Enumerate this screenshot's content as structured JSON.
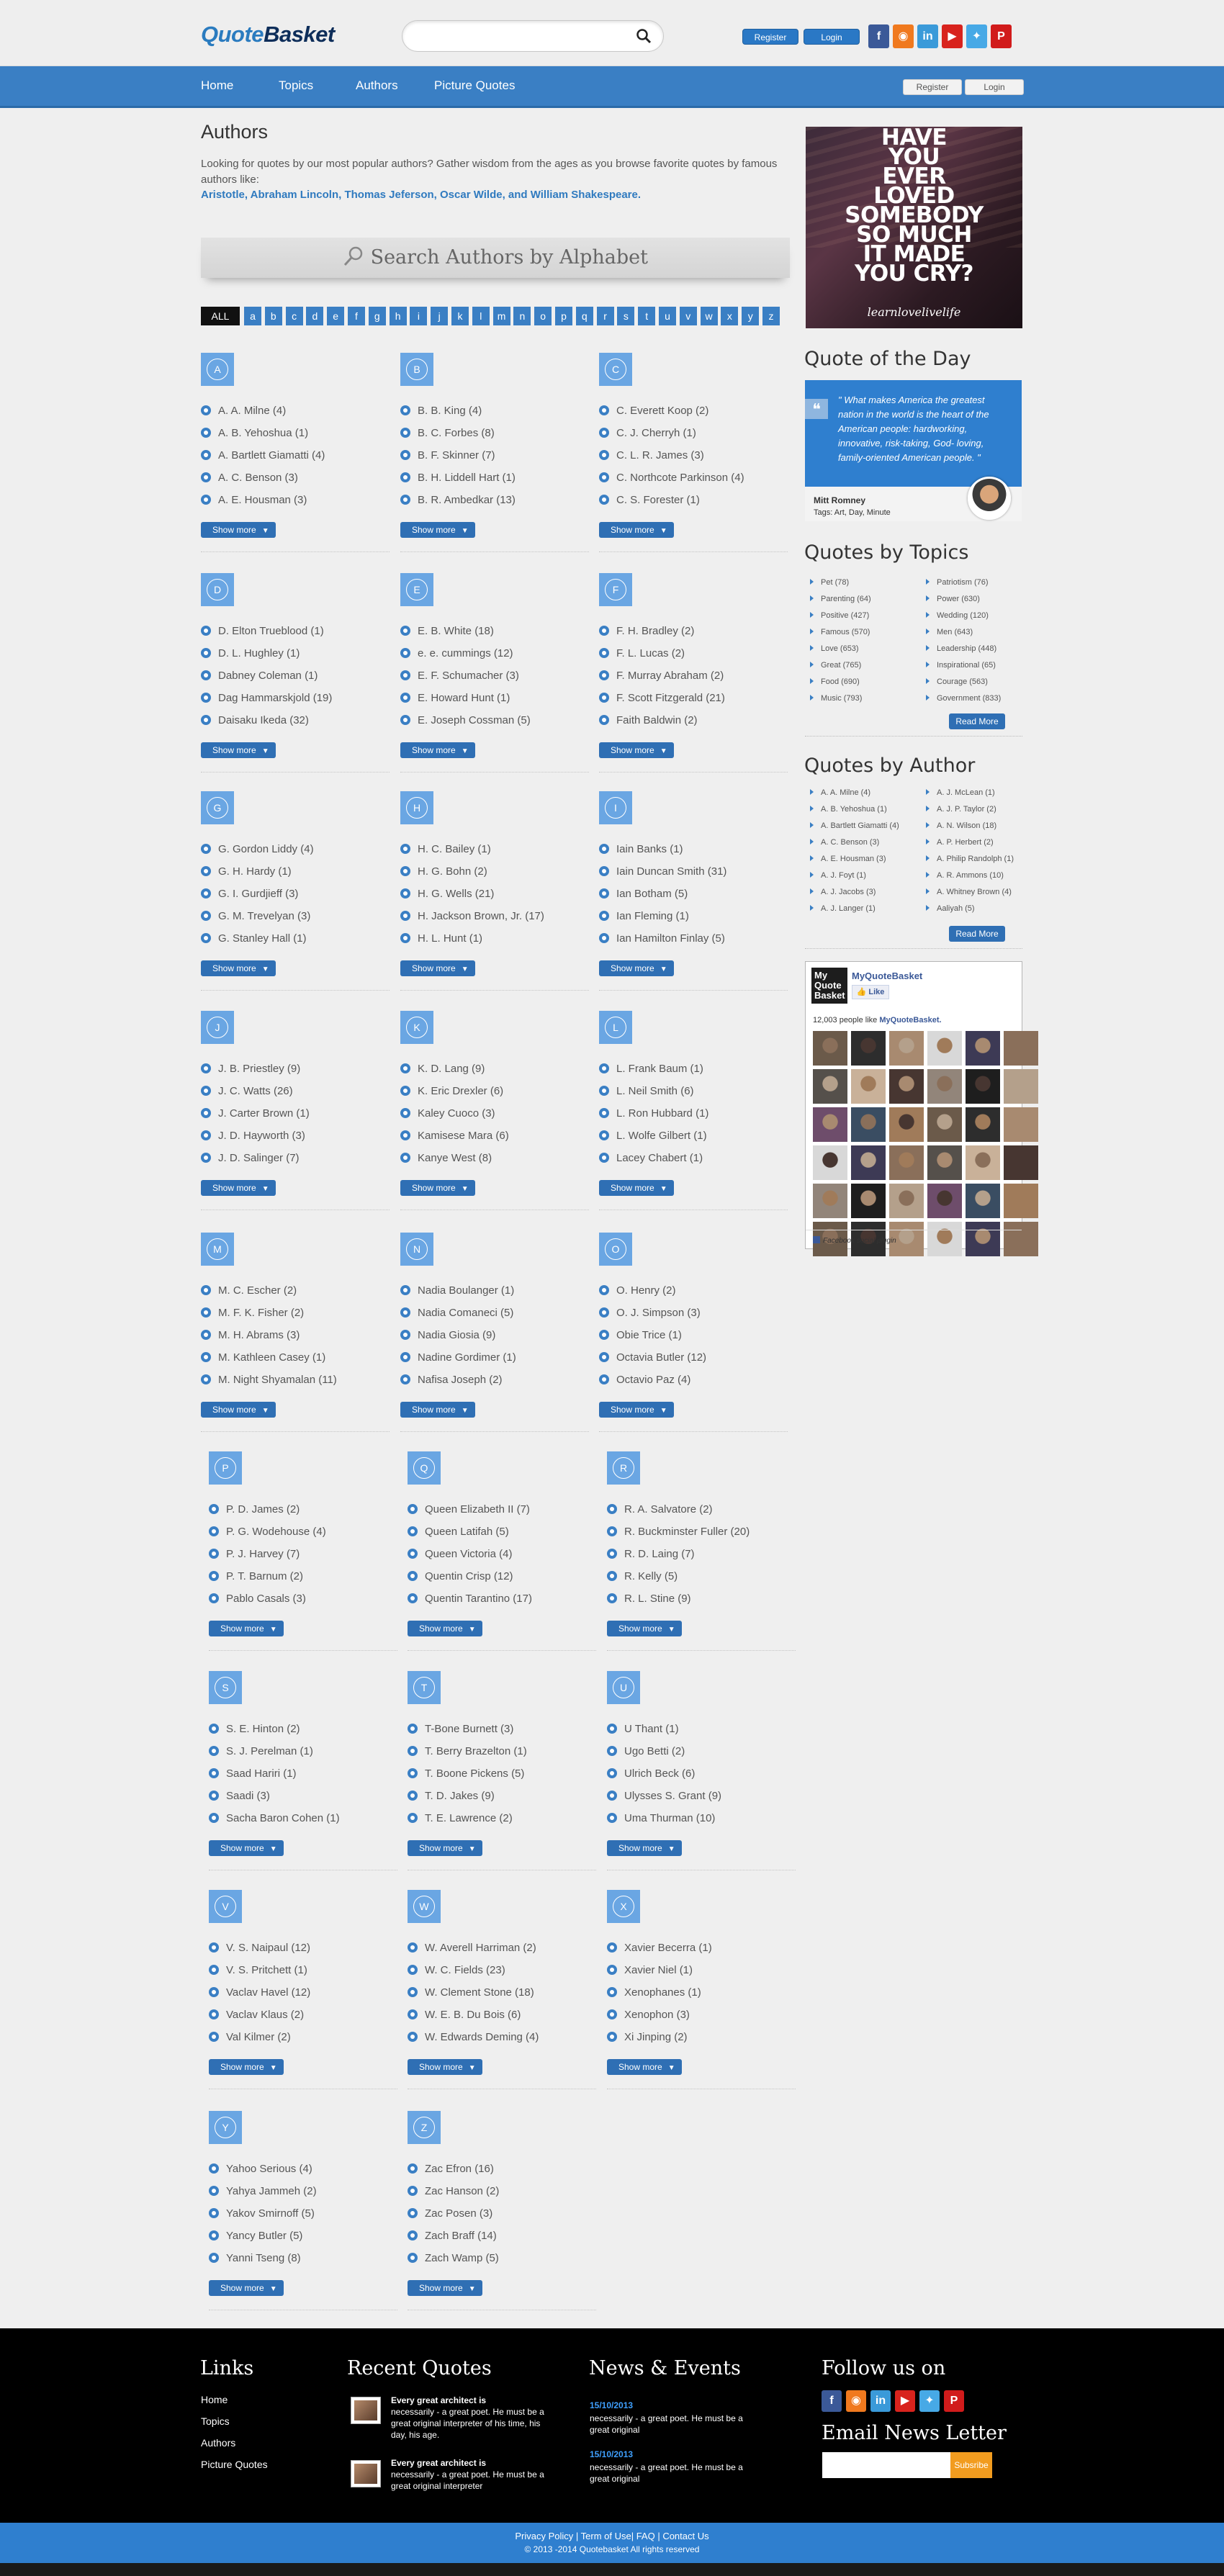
{
  "header": {
    "logo_part1": "Quote",
    "logo_part2": "Basket",
    "search_placeholder": "",
    "register_label": "Register",
    "login_label": "Login",
    "social": [
      {
        "name": "facebook-icon",
        "glyph": "f",
        "color": "#3b5998"
      },
      {
        "name": "rss-icon",
        "glyph": "◉",
        "color": "#f0791e"
      },
      {
        "name": "linkedin-icon",
        "glyph": "in",
        "color": "#3a9ad9"
      },
      {
        "name": "youtube-icon",
        "glyph": "▶",
        "color": "#d8231d"
      },
      {
        "name": "twitter-icon",
        "glyph": "✦",
        "color": "#47a9e6"
      },
      {
        "name": "pinterest-icon",
        "glyph": "P",
        "color": "#d11b1b"
      }
    ]
  },
  "nav": {
    "items": [
      "Home",
      "Topics",
      "Authors",
      "Picture Quotes"
    ],
    "register_label": "Register",
    "login_label": "Login"
  },
  "main": {
    "title": "Authors",
    "intro": "Looking for quotes by our most popular authors? Gather wisdom from the ages as you browse favorite quotes by famous authors like:",
    "famous": "Aristotle, Abraham Lincoln, Thomas Jeferson, Oscar Wilde, and William Shakespeare.",
    "search_heading": "Search Authors by Alphabet",
    "alphabet": [
      "ALL",
      "a",
      "b",
      "c",
      "d",
      "e",
      "f",
      "g",
      "h",
      "i",
      "j",
      "k",
      "l",
      "m",
      "n",
      "o",
      "p",
      "q",
      "r",
      "s",
      "t",
      "u",
      "v",
      "w",
      "x",
      "y",
      "z"
    ],
    "show_more_label": "Show more",
    "blocks": [
      {
        "letter": "A",
        "authors": [
          "A. A. Milne (4)",
          "A. B. Yehoshua (1)",
          "A. Bartlett Giamatti (4)",
          "A. C. Benson (3)",
          "A. E. Housman (3)"
        ]
      },
      {
        "letter": "B",
        "authors": [
          "B. B. King (4)",
          "B. C. Forbes (8)",
          "B. F. Skinner (7)",
          "B. H. Liddell Hart (1)",
          "B. R. Ambedkar (13)"
        ]
      },
      {
        "letter": "C",
        "authors": [
          "C. Everett Koop (2)",
          "C. J. Cherryh (1)",
          "C. L. R. James (3)",
          "C. Northcote Parkinson (4)",
          "C. S. Forester (1)"
        ]
      },
      {
        "letter": "D",
        "authors": [
          "D. Elton Trueblood (1)",
          "D. L. Hughley (1)",
          "Dabney Coleman (1)",
          "Dag Hammarskjold (19)",
          "Daisaku Ikeda (32)"
        ]
      },
      {
        "letter": "E",
        "authors": [
          "E. B. White (18)",
          "e. e. cummings (12)",
          "E. F. Schumacher (3)",
          "E. Howard Hunt (1)",
          "E. Joseph Cossman (5)"
        ]
      },
      {
        "letter": "F",
        "authors": [
          "F. H. Bradley (2)",
          "F. L. Lucas (2)",
          "F. Murray Abraham (2)",
          "F. Scott Fitzgerald (21)",
          "Faith Baldwin (2)"
        ]
      },
      {
        "letter": "G",
        "authors": [
          "G. Gordon Liddy (4)",
          "G. H. Hardy (1)",
          "G. I. Gurdjieff (3)",
          "G. M. Trevelyan (3)",
          "G. Stanley Hall (1)"
        ]
      },
      {
        "letter": "H",
        "authors": [
          "H. C. Bailey (1)",
          "H. G. Bohn (2)",
          "H. G. Wells (21)",
          "H. Jackson Brown, Jr. (17)",
          "H. L. Hunt (1)"
        ]
      },
      {
        "letter": "I",
        "authors": [
          "Iain Banks (1)",
          "Iain Duncan Smith (31)",
          "Ian Botham (5)",
          "Ian Fleming (1)",
          "Ian Hamilton Finlay (5)"
        ]
      },
      {
        "letter": "J",
        "authors": [
          "J. B. Priestley (9)",
          "J. C. Watts (26)",
          "J. Carter Brown (1)",
          "J. D. Hayworth (3)",
          "J. D. Salinger (7)"
        ]
      },
      {
        "letter": "K",
        "authors": [
          "K. D. Lang (9)",
          "K. Eric Drexler (6)",
          "Kaley Cuoco (3)",
          "Kamisese Mara (6)",
          "Kanye West (8)"
        ]
      },
      {
        "letter": "L",
        "authors": [
          "L. Frank Baum (1)",
          "L. Neil Smith (6)",
          "L. Ron Hubbard (1)",
          "L. Wolfe Gilbert (1)",
          "Lacey Chabert (1)"
        ]
      },
      {
        "letter": "M",
        "authors": [
          "M. C. Escher (2)",
          "M. F. K. Fisher (2)",
          "M. H. Abrams (3)",
          "M. Kathleen Casey (1)",
          "M. Night Shyamalan (11)"
        ]
      },
      {
        "letter": "N",
        "authors": [
          "Nadia Boulanger (1)",
          "Nadia Comaneci (5)",
          "Nadia Giosia (9)",
          "Nadine Gordimer (1)",
          "Nafisa Joseph (2)"
        ]
      },
      {
        "letter": "O",
        "authors": [
          "O. Henry (2)",
          "O. J. Simpson (3)",
          "Obie Trice (1)",
          "Octavia Butler (12)",
          "Octavio Paz (4)"
        ]
      },
      {
        "letter": "P",
        "authors": [
          "P. D. James (2)",
          "P. G. Wodehouse (4)",
          "P. J. Harvey (7)",
          "P. T. Barnum (2)",
          "Pablo Casals (3)"
        ]
      },
      {
        "letter": "Q",
        "authors": [
          "Queen Elizabeth II (7)",
          "Queen Latifah (5)",
          "Queen Victoria (4)",
          "Quentin Crisp (12)",
          "Quentin Tarantino (17)"
        ]
      },
      {
        "letter": "R",
        "authors": [
          "R. A. Salvatore (2)",
          "R. Buckminster Fuller (20)",
          "R. D. Laing (7)",
          "R. Kelly (5)",
          "R. L. Stine (9)"
        ]
      },
      {
        "letter": "S",
        "authors": [
          "S. E. Hinton (2)",
          "S. J. Perelman (1)",
          "Saad Hariri (1)",
          "Saadi (3)",
          "Sacha Baron Cohen (1)"
        ]
      },
      {
        "letter": "T",
        "authors": [
          "T-Bone Burnett (3)",
          "T. Berry Brazelton (1)",
          "T. Boone Pickens (5)",
          "T. D. Jakes (9)",
          "T. E. Lawrence (2)"
        ]
      },
      {
        "letter": "U",
        "authors": [
          "U Thant (1)",
          "Ugo Betti (2)",
          "Ulrich Beck (6)",
          "Ulysses S. Grant (9)",
          "Uma Thurman (10)"
        ]
      },
      {
        "letter": "V",
        "authors": [
          "V. S. Naipaul (12)",
          "V. S. Pritchett (1)",
          "Vaclav Havel (12)",
          "Vaclav Klaus (2)",
          "Val Kilmer (2)"
        ]
      },
      {
        "letter": "W",
        "authors": [
          "W. Averell Harriman (2)",
          "W. C. Fields (23)",
          "W. Clement Stone (18)",
          "W. E. B. Du Bois (6)",
          "W. Edwards Deming (4)"
        ]
      },
      {
        "letter": "X",
        "authors": [
          "Xavier Becerra (1)",
          "Xavier Niel (1)",
          "Xenophanes (1)",
          "Xenophon (3)",
          "Xi Jinping (2)"
        ]
      },
      {
        "letter": "Y",
        "authors": [
          "Yahoo Serious (4)",
          "Yahya Jammeh (2)",
          "Yakov Smirnoff (5)",
          "Yancy Butler (5)",
          "Yanni Tseng (8)"
        ]
      },
      {
        "letter": "Z",
        "authors": [
          "Zac Efron (16)",
          "Zac Hanson (2)",
          "Zac Posen (3)",
          "Zach Braff (14)",
          "Zach Wamp (5)"
        ]
      }
    ]
  },
  "sidebar": {
    "ad_text": [
      "HAVE",
      "YOU",
      "EVER",
      "LOVED",
      "SOMEBODY",
      "SO MUCH",
      "IT MADE",
      "YOU CRY?"
    ],
    "ad_signature": "learnlovelivelife",
    "qotd_heading": "Quote of the Day",
    "qotd_quote": "\" What makes America the greatest nation in the world is the heart of the American people: hardworking, innovative, risk-taking, God- loving, family-oriented American people. \"",
    "qotd_author": "Mitt Romney",
    "qotd_tags": "Tags: Art, Day, Minute",
    "topics_heading": "Quotes by Topics",
    "topics_left": [
      "Pet (78)",
      "Parenting (64)",
      "Positive (427)",
      "Famous (570)",
      "Love (653)",
      "Great (765)",
      "Food (690)",
      "Music (793)"
    ],
    "topics_right": [
      "Patriotism (76)",
      "Power (630)",
      "Wedding (120)",
      "Men (643)",
      "Leadership (448)",
      "Inspirational (65)",
      "Courage (563)",
      "Government (833)"
    ],
    "read_more": "Read More",
    "author_heading": "Quotes by Author",
    "authors_left": [
      "A. A. Milne (4)",
      "A. B. Yehoshua (1)",
      "A. Bartlett Giamatti (4)",
      "A. C. Benson (3)",
      "A. E. Housman (3)",
      "A. J. Foyt (1)",
      "A. J. Jacobs (3)",
      "A. J. Langer (1)"
    ],
    "authors_right": [
      "A. J. McLean (1)",
      "A. J. P. Taylor (2)",
      "A. N. Wilson (18)",
      "A. P. Herbert (2)",
      "A. Philip Randolph (1)",
      "A. R. Ammons (10)",
      "A. Whitney Brown (4)",
      "Aaliyah (5)"
    ],
    "fb": {
      "logo_text": "My Quote Basket",
      "title": "MyQuoteBasket",
      "like": "Like",
      "count_prefix": "12,003 people like ",
      "count_name": "MyQuoteBasket.",
      "footer": "Facebook social plugin"
    }
  },
  "footer": {
    "links_heading": "Links",
    "links": [
      "Home",
      "Topics",
      "Authors",
      "Picture Quotes"
    ],
    "recent_heading": "Recent Quotes",
    "recent": [
      {
        "bold": "Every great architect is",
        "text": "necessarily - a great poet. He must be a great original interpreter of his time, his day, his age."
      },
      {
        "bold": "Every great architect is",
        "text": "necessarily - a great poet. He must be a great original interpreter"
      }
    ],
    "news_heading": "News & Events",
    "news": [
      {
        "date": "15/10/2013",
        "text": "necessarily - a great poet. He must be a great original"
      },
      {
        "date": "15/10/2013",
        "text": "necessarily - a great poet. He must be a great original"
      }
    ],
    "follow_heading": "Follow us on",
    "newsletter_heading": "Email News Letter",
    "subscribe": "Subsribe",
    "bottom_links": "Privacy Policy | Term of Use| FAQ | Contact Us",
    "copyright": "© 2013 -2014 Quotebasket All rights reserved"
  }
}
